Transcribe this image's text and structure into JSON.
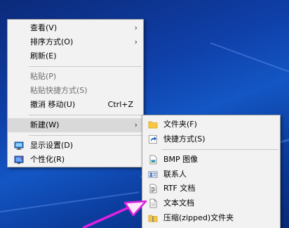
{
  "main_menu": {
    "items": [
      {
        "label": "查看(V)",
        "submenu": true
      },
      {
        "label": "排序方式(O)",
        "submenu": true
      },
      {
        "label": "刷新(E)"
      },
      {
        "label": "粘贴(P)",
        "disabled": true
      },
      {
        "label": "粘贴快捷方式(S)",
        "disabled": true
      },
      {
        "label": "撤消 移动(U)",
        "shortcut": "Ctrl+Z"
      },
      {
        "label": "新建(W)",
        "submenu": true,
        "highlighted": true
      },
      {
        "label": "显示设置(D)",
        "icon": "display-settings-icon"
      },
      {
        "label": "个性化(R)",
        "icon": "personalize-icon"
      }
    ],
    "arrow_glyph": "›"
  },
  "sub_menu": {
    "items": [
      {
        "label": "文件夹(F)",
        "icon": "folder-icon"
      },
      {
        "label": "快捷方式(S)",
        "icon": "shortcut-icon"
      },
      {
        "label": "BMP 图像",
        "icon": "bmp-image-icon"
      },
      {
        "label": "联系人",
        "icon": "contact-icon"
      },
      {
        "label": "RTF 文档",
        "icon": "rtf-document-icon"
      },
      {
        "label": "文本文档",
        "icon": "text-document-icon"
      },
      {
        "label": "压缩(zipped)文件夹",
        "icon": "zip-folder-icon"
      }
    ]
  },
  "colors": {
    "menu_bg": "#f2f2f2",
    "highlight": "#d9d9d9",
    "annotation_arrow": "#e020e0",
    "desktop": "#1356c4"
  }
}
